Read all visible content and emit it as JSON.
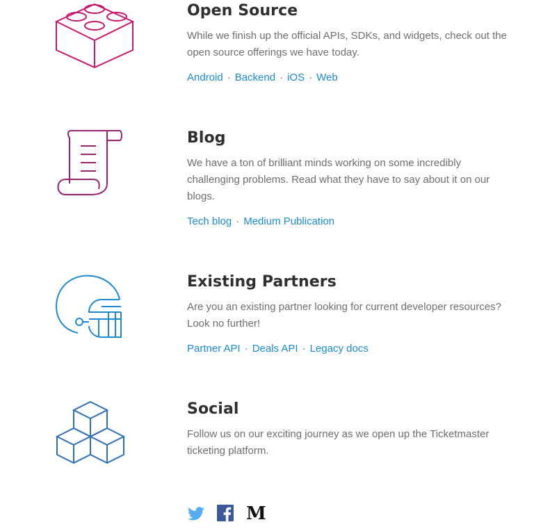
{
  "sections": [
    {
      "title": "Open Source",
      "description": "While we finish up the official APIs, SDKs, and widgets, check out the open source offerings we have today.",
      "links": [
        "Android",
        "Backend",
        "iOS",
        "Web"
      ],
      "icon": "lego-brick-icon",
      "icon_color": "#c8176e"
    },
    {
      "title": "Blog",
      "description": "We have a ton of brilliant minds working on some incredibly challenging problems. Read what they have to say about it on our blogs.",
      "links": [
        "Tech blog",
        "Medium Publication"
      ],
      "icon": "scroll-icon",
      "icon_color": "#9a2270"
    },
    {
      "title": "Existing Partners",
      "description": "Are you an existing partner looking for current developer resources? Look no further!",
      "links": [
        "Partner API",
        "Deals API",
        "Legacy docs"
      ],
      "icon": "football-helmet-icon",
      "icon_color": "#1a8bd0"
    },
    {
      "title": "Social",
      "description": "Follow us on our exciting journey as we open up the Ticketmaster ticketing platform.",
      "links": [],
      "icon": "stacked-cubes-icon",
      "icon_color": "#2f6fb7"
    }
  ],
  "social": {
    "twitter": "twitter-icon",
    "facebook": "facebook-icon",
    "medium": "medium-icon",
    "medium_letter": "M"
  },
  "colors": {
    "link": "#1a8bd0",
    "heading": "#2f2f2f",
    "body": "#6e6e6e"
  }
}
